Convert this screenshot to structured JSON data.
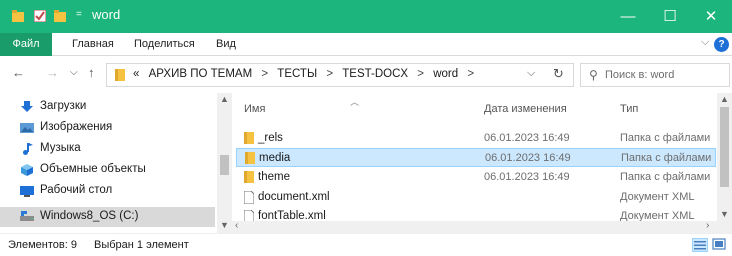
{
  "window": {
    "title": "word",
    "title_separator": "=",
    "controls": {
      "minimize": "—",
      "maximize": "☐",
      "close": "✕"
    }
  },
  "ribbon": {
    "tabs": [
      "Файл",
      "Главная",
      "Поделиться",
      "Вид"
    ],
    "expand_glyph": "⌵",
    "help_glyph": "?"
  },
  "address": {
    "overflow": "«",
    "crumbs": [
      "АРХИВ ПО ТЕМАМ",
      "ТЕСТЫ",
      "TEST-DOCX",
      "word"
    ],
    "separator": ">",
    "dropdown_glyph": "⌵",
    "refresh_glyph": "↻"
  },
  "search": {
    "placeholder": "Поиск в: word"
  },
  "nav_pane": {
    "items": [
      {
        "label": "Загрузки",
        "icon": "downloads-icon"
      },
      {
        "label": "Изображения",
        "icon": "pictures-icon"
      },
      {
        "label": "Музыка",
        "icon": "music-icon"
      },
      {
        "label": "Объемные объекты",
        "icon": "3d-objects-icon"
      },
      {
        "label": "Рабочий стол",
        "icon": "desktop-icon"
      },
      {
        "label": "Windows8_OS (C:)",
        "icon": "drive-icon",
        "selected": true
      }
    ]
  },
  "file_list": {
    "columns": {
      "name": "Имя",
      "date": "Дата изменения",
      "type": "Тип"
    },
    "rows": [
      {
        "name": "_rels",
        "date": "06.01.2023 16:49",
        "type": "Папка с файлами",
        "icon": "folder-icon"
      },
      {
        "name": "media",
        "date": "06.01.2023 16:49",
        "type": "Папка с файлами",
        "icon": "folder-icon",
        "selected": true
      },
      {
        "name": "theme",
        "date": "06.01.2023 16:49",
        "type": "Папка с файлами",
        "icon": "folder-icon"
      },
      {
        "name": "document.xml",
        "date": "",
        "type": "Документ XML",
        "icon": "xml-file-icon"
      },
      {
        "name": "fontTable.xml",
        "date": "",
        "type": "Документ XML",
        "icon": "xml-file-icon"
      }
    ]
  },
  "status": {
    "items_count": "Элементов: 9",
    "selection": "Выбран 1 элемент"
  },
  "colors": {
    "titlebar": "#1cb57e",
    "file_tab": "#1a9b6a",
    "selection": "#cce8ff",
    "folder": "#f5c242"
  }
}
